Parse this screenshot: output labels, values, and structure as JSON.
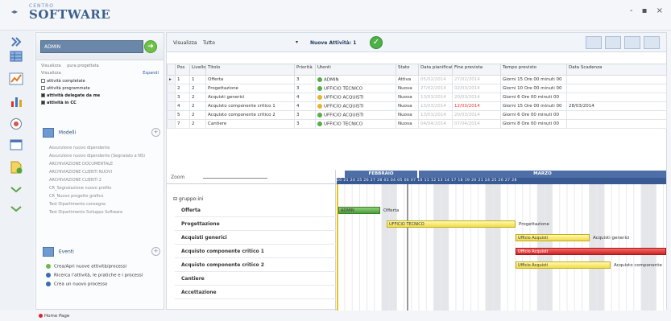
{
  "window": {
    "logo_top": "CENTRO",
    "logo_main": "SOFTWARE",
    "controls": "- ▪ ×"
  },
  "sidebar": {
    "combo_value": "ADMIN",
    "search_label": "Visualizza",
    "search_value": "pura progettata",
    "filter_label": "Visualizza",
    "filter_link": "Espandi",
    "filters": [
      {
        "label": "attività completate",
        "checked": false
      },
      {
        "label": "attività programmate",
        "checked": false
      },
      {
        "label": "attività delegate da me",
        "checked": true
      },
      {
        "label": "attività in CC",
        "checked": true
      }
    ],
    "models_title": "Modelli",
    "models": [
      "Assunzione nuovo dipendente",
      "Assunzione nuovo dipendente (Segnalato a NS)",
      "ARCHIVIAZIONE DOCUMENTALE",
      "ARCHIVIAZIONE CLIENTI NUOVI",
      "ARCHIVIAZIONE CLIENTI 2",
      "CR_Segnalazione nuovo profilo",
      "CR_Nuovo progetto grafico",
      "Test Dipartimento consegne",
      "Test Dipartimento Sviluppo Software"
    ],
    "events_title": "Eventi",
    "actions": [
      "Crea/Apri nuove attività/processi",
      "Ricerca l'attività, le pratiche e i processi",
      "Crea un nuovo processo"
    ]
  },
  "toolbar": {
    "label": "Visualizza",
    "value": "Tutto",
    "activities": "Nuove Attività: 1"
  },
  "grid": {
    "headers": [
      "",
      "Pos",
      "Livello",
      "Titolo",
      "Priorità",
      "Utenti",
      "Stato",
      "Data pianificata",
      "Fine prevista",
      "Tempo previsto",
      "Data Scadenza"
    ],
    "rows": [
      {
        "marker": "▸",
        "pos": "1",
        "liv": "1",
        "title": "Offerta",
        "prio": "3",
        "user": "ADMIN",
        "ucol": "g",
        "stato": "Attiva",
        "data": "05/02/2014",
        "fine": "27/02/2014",
        "tempo": "Giorni 15 Ore 00 minuti 00",
        "scad": ""
      },
      {
        "marker": "",
        "pos": "2",
        "liv": "2",
        "title": "Progettazione",
        "prio": "3",
        "user": "UFFICIO TECNICO",
        "ucol": "g",
        "stato": "Nuova",
        "data": "27/02/2014",
        "fine": "02/03/2014",
        "tempo": "Giorni 10 Ore 00 minuti 00",
        "scad": ""
      },
      {
        "marker": "",
        "pos": "3",
        "liv": "2",
        "title": "Acquisti generici",
        "prio": "4",
        "user": "UFFICIO ACQUISTI",
        "ucol": "y",
        "stato": "Nuova",
        "data": "13/03/2014",
        "fine": "20/03/2014",
        "tempo": "Giorni 6 Ore 00 minuti 00",
        "scad": ""
      },
      {
        "marker": "",
        "pos": "4",
        "liv": "2",
        "title": "Acquisto componente critico 1",
        "prio": "4",
        "user": "UFFICIO ACQUISTI",
        "ucol": "y",
        "stato": "Nuova",
        "data": "13/03/2014",
        "fine": "12/03/2014",
        "tempo": "Giorni 15 Ore 00 minuti 00",
        "scad": "28/03/2014"
      },
      {
        "marker": "",
        "pos": "5",
        "liv": "2",
        "title": "Acquisto componente critico 2",
        "prio": "3",
        "user": "UFFICIO ACQUISTI",
        "ucol": "g",
        "stato": "Nuova",
        "data": "13/03/2014",
        "fine": "20/03/2014",
        "tempo": "Giorni 6 Ore 00 minuti 00",
        "scad": ""
      },
      {
        "marker": "",
        "pos": "7",
        "liv": "2",
        "title": "Cantiere",
        "prio": "3",
        "user": "UFFICIO TECNICO",
        "ucol": "g",
        "stato": "Nuova",
        "data": "04/04/2014",
        "fine": "07/04/2014",
        "tempo": "Giorni 8 Ore 00 minuti 00",
        "scad": ""
      }
    ]
  },
  "gantt": {
    "scale_label": "Zoom",
    "group": "gruppo:ini",
    "months": [
      "FEBBRAIO",
      "MARZO"
    ],
    "days": "20 21 24 25 26 27 28 03 04 05 06 07 10 11 12 13 14 17 18 19 20 21 24 25 26 27 28",
    "rows": [
      "Offerta",
      "Progettazione",
      "Acquisti generici",
      "Acquisto componente critico 1",
      "Acquisto componente critico 2",
      "Cantiere",
      "Accettazione"
    ],
    "bars": [
      {
        "label": "ADMIN",
        "after": "Offerta",
        "color": "bar-green"
      },
      {
        "label": "UFFICIO TECNICO",
        "after": "Progettazione",
        "color": "bar-yellow"
      },
      {
        "label": "Ufficio Acquisti",
        "after": "Acquisti generici",
        "color": "bar-yellow"
      },
      {
        "label": "Ufficio Acquisti",
        "after": "",
        "color": "bar-red"
      },
      {
        "label": "Ufficio Acquisti",
        "after": "Acquisto componente",
        "color": "bar-yellow"
      }
    ]
  },
  "statusbar": {
    "text": "Home Page"
  }
}
